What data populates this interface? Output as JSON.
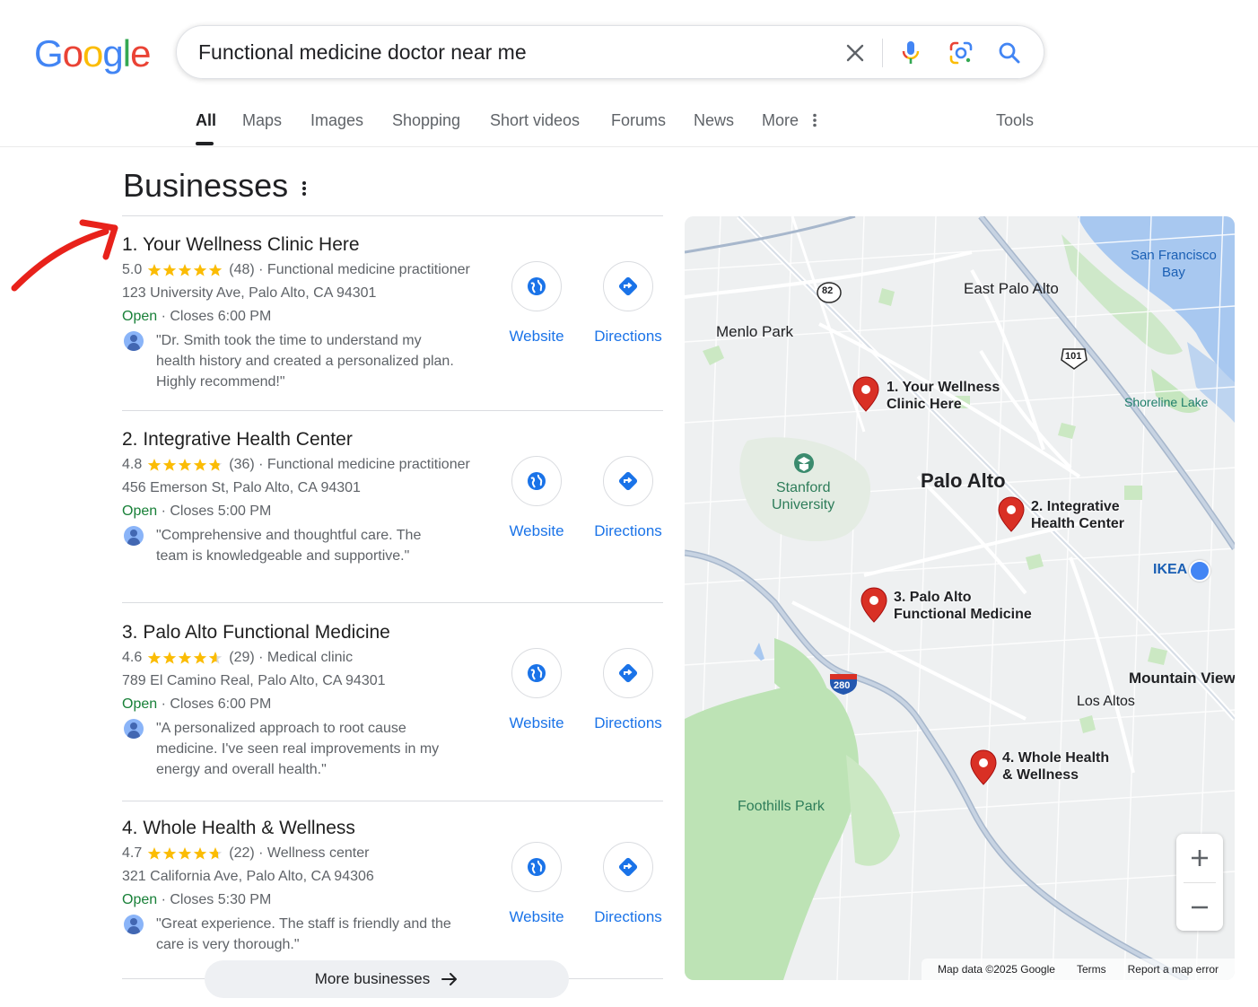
{
  "logo": {
    "letters": [
      "G",
      "o",
      "o",
      "g",
      "l",
      "e"
    ],
    "colors": [
      "#4285F4",
      "#EA4335",
      "#FBBC05",
      "#4285F4",
      "#34A853",
      "#EA4335"
    ]
  },
  "search": {
    "query": "Functional medicine doctor near me"
  },
  "tabs": [
    {
      "label": "All",
      "active": true
    },
    {
      "label": "Maps"
    },
    {
      "label": "Images"
    },
    {
      "label": "Shopping"
    },
    {
      "label": "Short videos"
    },
    {
      "label": "Forums"
    },
    {
      "label": "News"
    },
    {
      "label": "More"
    }
  ],
  "tools_label": "Tools",
  "businesses": {
    "title": "Businesses",
    "listings": [
      {
        "name": "1. Your Wellness Clinic Here",
        "rating": "5.0",
        "rating_value": 5.0,
        "reviews": "(48)",
        "category": "· Functional medicine practitioner",
        "address": "123 University Ave, Palo Alto, CA 94301",
        "status": "Open",
        "hours": "· Closes 6:00 PM",
        "review": "\"Dr. Smith took the time to understand my health history and created a personalized plan. Highly recommend!\""
      },
      {
        "name": "2. Integrative Health Center",
        "rating": "4.8",
        "rating_value": 4.8,
        "reviews": "(36)",
        "category": "· Functional medicine practitioner",
        "address": "456 Emerson St, Palo Alto, CA 94301",
        "status": "Open",
        "hours": "· Closes 5:00 PM",
        "review": "\"Comprehensive and thoughtful care. The team is knowledgeable and supportive.\""
      },
      {
        "name": "3. Palo Alto Functional Medicine",
        "rating": "4.6",
        "rating_value": 4.6,
        "reviews": "(29)",
        "category": "· Medical clinic",
        "address": "789 El Camino Real, Palo Alto, CA 94301",
        "status": "Open",
        "hours": "· Closes 6:00 PM",
        "review": "\"A personalized approach to root cause medicine. I've seen real improvements in my energy and overall health.\""
      },
      {
        "name": "4. Whole Health & Wellness",
        "rating": "4.7",
        "rating_value": 4.7,
        "reviews": "(22)",
        "category": "· Wellness center",
        "address": "321 California Ave, Palo Alto, CA 94306",
        "status": "Open",
        "hours": "· Closes 5:30 PM",
        "review": "\"Great experience. The staff is friendly and the care is very thorough.\""
      }
    ],
    "website_label": "Website",
    "directions_label": "Directions",
    "more_label": "More businesses"
  },
  "map": {
    "places": {
      "sf_bay_1": "San Francisco",
      "sf_bay_2": "Bay",
      "east_palo_alto": "East Palo Alto",
      "menlo_park": "Menlo Park",
      "shoreline_lake": "Shoreline Lake",
      "stanford_1": "Stanford",
      "stanford_2": "University",
      "palo_alto": "Palo Alto",
      "ikea": "IKEA",
      "mountain_view": "Mountain View",
      "los_altos": "Los Altos",
      "foothills_park": "Foothills Park"
    },
    "shields": {
      "r82": "82",
      "us101": "101",
      "i280": "280"
    },
    "pins": [
      {
        "line1": "1. Your Wellness",
        "line2": "Clinic Here"
      },
      {
        "line1": "2. Integrative",
        "line2": "Health Center"
      },
      {
        "line1": "3. Palo Alto",
        "line2": "Functional Medicine"
      },
      {
        "line1": "4. Whole Health",
        "line2": "& Wellness"
      }
    ],
    "attribution": {
      "data": "Map data ©2025 Google",
      "terms": "Terms",
      "report": "Report a map error"
    }
  },
  "colors": {
    "accent": "#1a73e8",
    "open": "#188038",
    "star": "#fbbc04",
    "pin": "#d93025"
  }
}
